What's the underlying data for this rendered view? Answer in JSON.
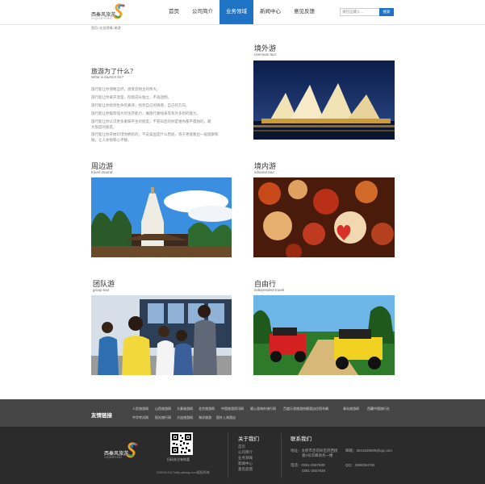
{
  "header": {
    "logo_text": "西秦风旅游",
    "logo_sub": "XIQINFENG",
    "nav": [
      {
        "label": "首页",
        "active": false
      },
      {
        "label": "公司简介",
        "active": false
      },
      {
        "label": "业务领域",
        "active": true
      },
      {
        "label": "新闻中心",
        "active": false
      },
      {
        "label": "意见反馈",
        "active": false
      }
    ],
    "search_placeholder": "请在这输入...",
    "search_button": "搜索"
  },
  "breadcrumb": "首页>业务领域>旅游",
  "intro": {
    "question": "旅游为了什么？",
    "question_en": "What is tourism for?",
    "lines": [
      "旅行能让你领略自然，感受造物主的伟大。",
      "旅行能让你离开温室，彻底成长独立，不再迷惘。",
      "旅行能让你找到生命的真谛，找到自己的情感，自己的方向。",
      "旅行能让你锻炼强大的生存能力，做旅行路线表等有许多别的能力。",
      "旅行能让你认识更多素昧平生的朋友，不管日后的你是谁你都不孤独的，最",
      "大限度的朋友。",
      "旅行能让你开始珍惜你拥有的，不说美国是什么憋屈，等于更能看出一般观察和",
      "融，让人体悟和心平静。"
    ]
  },
  "sections": [
    {
      "id": "overseas",
      "title": "境外游",
      "subtitle": "overseas tour"
    },
    {
      "id": "around",
      "title": "周边游",
      "subtitle": "travel around"
    },
    {
      "id": "inbound",
      "title": "境内游",
      "subtitle": "inbound tour"
    },
    {
      "id": "group",
      "title": "团队游",
      "subtitle": "group tour"
    },
    {
      "id": "independent",
      "title": "自由行",
      "subtitle": "independent travel"
    }
  ],
  "footer": {
    "links_title": "友情链接",
    "links_row1": [
      "人民旅游网",
      "山西旅游网",
      "大秦旅游网",
      "北京旅游网",
      "中国旅游资讯网",
      "随心游海外旅行网",
      "百度乐游旅游快捷酒店住宿车辆",
      "青岛旅游网",
      "西藏中国旅行社"
    ],
    "links_row2": [
      "中华考试网",
      "阳光旅行网",
      "大连旅游网",
      "海洋旅游",
      "国外上海酒店"
    ],
    "logo_text": "西秦风旅游",
    "logo_sub": "XIQINFENG",
    "qr_label": "扫码关注有惊喜",
    "copyright": "©2009-2017xifly-qifang.com版权所有",
    "about_title": "关于我们",
    "about_items": [
      "首页",
      "公司简介",
      "业务领域",
      "新闻中心",
      "意见反馈"
    ],
    "contact_title": "联系我们",
    "contact_address": "地址：太原市杏花岭区府西街",
    "contact_address2": "壹2号华峰商务一楼",
    "contact_email": "邮箱：2841639508@qq.com",
    "contact_phone": "电话：0351-2557939",
    "contact_phone2": "0351-2557939",
    "contact_qq": "QQ：2568284752"
  },
  "colors": {
    "accent": "#1f73c4",
    "footer_dark": "#2b2b2b",
    "footer_band": "#454545"
  }
}
